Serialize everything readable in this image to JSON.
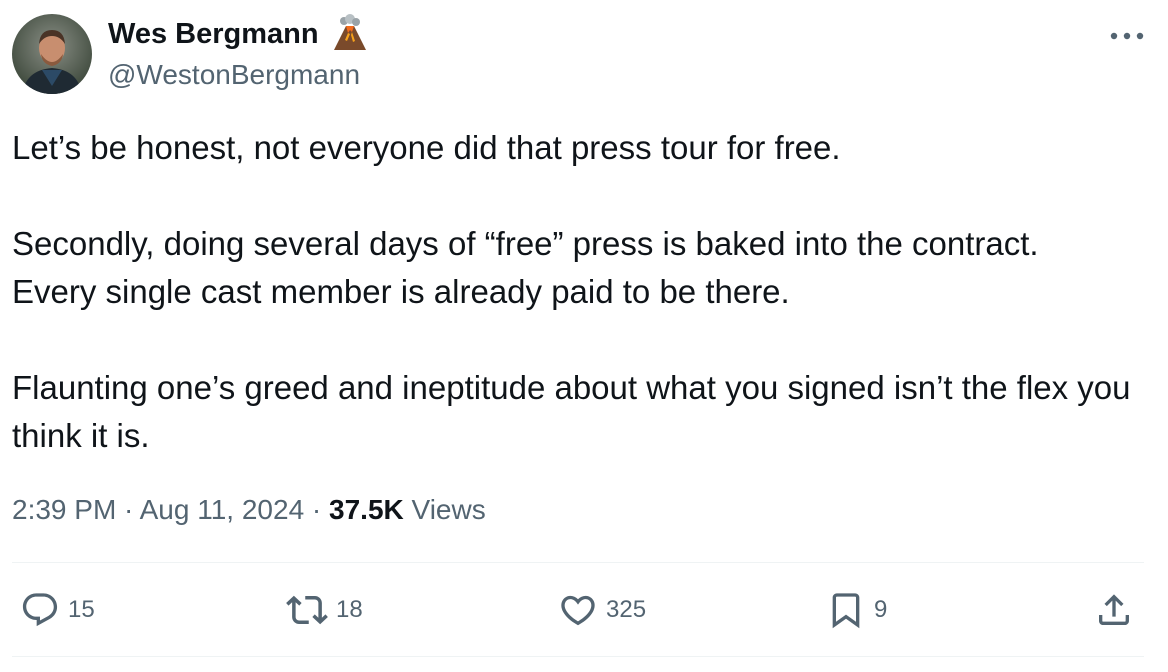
{
  "author": {
    "name": "Wes Bergmann",
    "name_emoji": "volcano-emoji",
    "handle": "@WestonBergmann",
    "avatar": "profile-photo"
  },
  "tweet": {
    "paragraphs": [
      "Let’s be honest, not everyone did that press tour for free.",
      "Secondly, doing several days of “free” press is baked into the contract.\nEvery single cast member is already paid to be there.",
      "Flaunting one’s greed and ineptitude about what you signed isn’t the flex you think it is."
    ]
  },
  "meta": {
    "time": "2:39 PM",
    "sep1": " · ",
    "date": "Aug 11, 2024",
    "sep2": " · ",
    "views_count": "37.5K",
    "views_label": " Views"
  },
  "actions": {
    "replies": {
      "icon": "reply-icon",
      "count": "15"
    },
    "reposts": {
      "icon": "repost-icon",
      "count": "18"
    },
    "likes": {
      "icon": "heart-icon",
      "count": "325"
    },
    "bookmarks": {
      "icon": "bookmark-icon",
      "count": "9"
    },
    "share": {
      "icon": "share-icon"
    }
  },
  "colors": {
    "text_primary": "#0f1419",
    "text_secondary": "#536471",
    "divider": "#eff3f4"
  }
}
